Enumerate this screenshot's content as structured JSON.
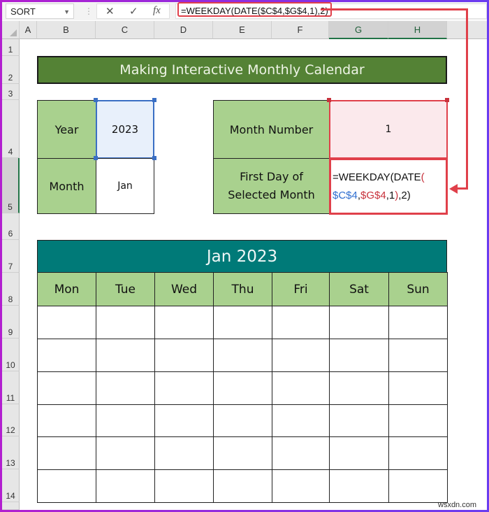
{
  "formula_bar": {
    "name_box": "SORT",
    "cancel_icon": "✕",
    "enter_icon": "✓",
    "fx_label": "fx",
    "formula": "=WEEKDAY(DATE($C$4,$G$4,1),2)"
  },
  "columns": [
    "A",
    "B",
    "C",
    "D",
    "E",
    "F",
    "G",
    "H"
  ],
  "selected_columns": [
    "G",
    "H"
  ],
  "rows": [
    "1",
    "2",
    "3",
    "4",
    "5",
    "6",
    "7",
    "8",
    "9",
    "10",
    "11",
    "12",
    "13",
    "14"
  ],
  "selected_rows": [
    "5"
  ],
  "sheet": {
    "title": "Making Interactive Monthly Calendar",
    "year_label": "Year",
    "year_value": "2023",
    "month_label": "Month",
    "month_value": "Jan",
    "month_number_label": "Month Number",
    "month_number_value": "1",
    "first_day_label_line1": "First Day of",
    "first_day_label_line2": "Selected Month",
    "first_day_formula": {
      "line1_prefix": "=WEEKDAY(DATE",
      "line1_paren": "(",
      "ref_year": "$C$4",
      "comma1": ",",
      "ref_month": "$G$4",
      "rest_a": ",1",
      "paren_close": ")",
      "rest_b": ",2)"
    }
  },
  "calendar": {
    "title": "Jan 2023",
    "weekdays": [
      "Mon",
      "Tue",
      "Wed",
      "Thu",
      "Fri",
      "Sat",
      "Sun"
    ],
    "weeks": 6
  },
  "colors": {
    "title_green": "#548235",
    "label_green": "#a9d18e",
    "calendar_teal": "#007a78",
    "highlight_red": "#e0404a",
    "selection_blue": "#3a6fc4"
  },
  "watermark": "wsxdn.com"
}
